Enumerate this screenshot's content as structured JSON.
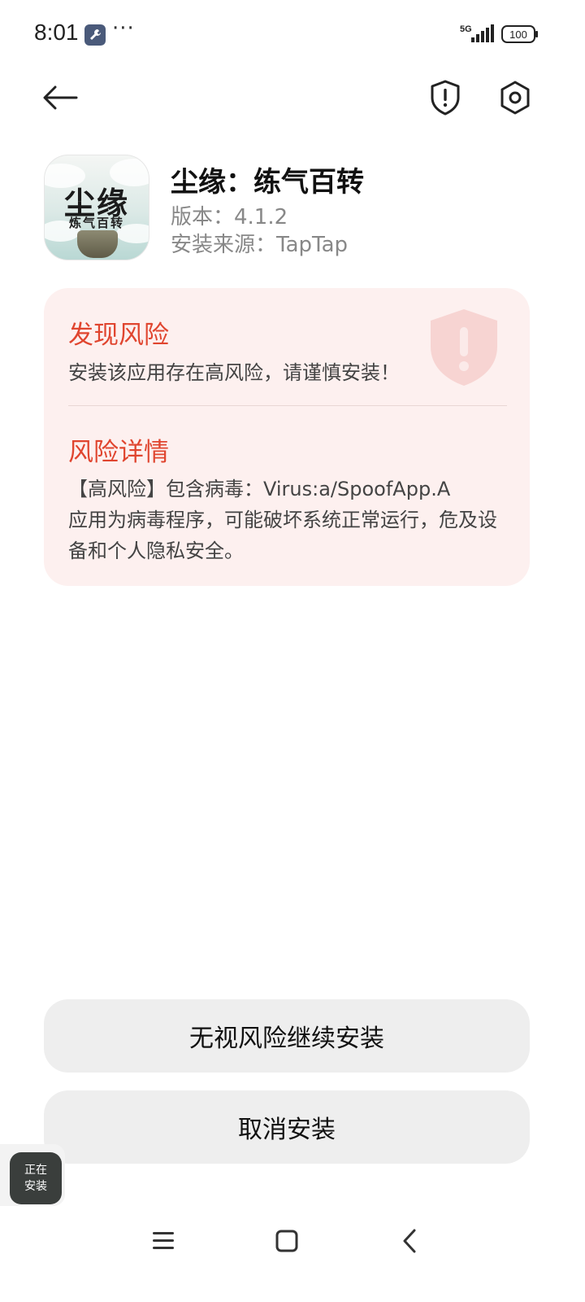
{
  "status_bar": {
    "time": "8:01",
    "dots": "···",
    "network": "5G",
    "battery": "100"
  },
  "header": {
    "icons": [
      "back-arrow-icon",
      "shield-alert-icon",
      "settings-icon"
    ]
  },
  "app": {
    "name": "尘缘：练气百转",
    "version": "版本：4.1.2",
    "source": "安装来源：TapTap",
    "icon_title": "尘缘",
    "icon_subtitle": "炼气百转"
  },
  "risk": {
    "title": "发现风险",
    "description": "安装该应用存在高风险，请谨慎安装！",
    "detail_title": "风险详情",
    "detail_line1": "【高风险】包含病毒：Virus:a/SpoofApp.A",
    "detail_line2": "应用为病毒程序，可能破坏系统正常运行，危及设备和个人隐私安全。",
    "accent_color": "#e0452f",
    "card_color": "#fdf0ef"
  },
  "actions": {
    "continue_label": "无视风险继续安装",
    "cancel_label": "取消安装"
  },
  "installing_bubble": {
    "line1": "正在",
    "line2": "安装"
  },
  "nav": {
    "icons": [
      "menu-icon",
      "home-icon",
      "back-icon"
    ]
  }
}
